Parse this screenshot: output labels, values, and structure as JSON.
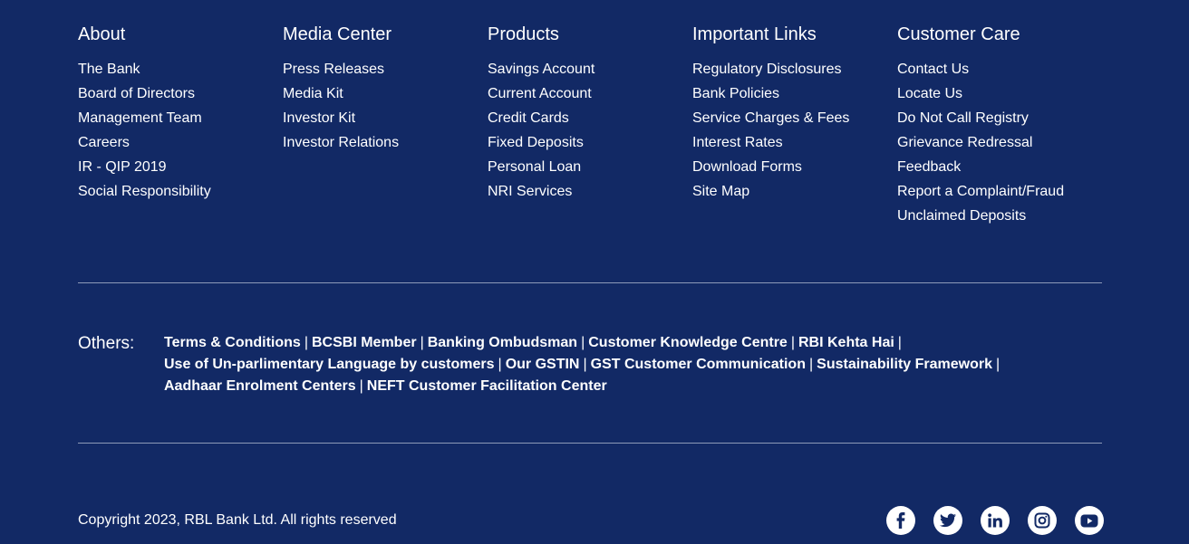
{
  "columns": [
    {
      "title": "About",
      "links": [
        "The Bank",
        "Board of Directors",
        "Management Team",
        "Careers",
        "IR - QIP 2019",
        "Social Responsibility"
      ]
    },
    {
      "title": "Media Center",
      "links": [
        "Press Releases",
        "Media Kit",
        "Investor Kit",
        "Investor Relations"
      ]
    },
    {
      "title": "Products",
      "links": [
        "Savings Account",
        "Current Account",
        "Credit Cards",
        "Fixed Deposits",
        "Personal Loan",
        "NRI Services"
      ]
    },
    {
      "title": "Important Links",
      "links": [
        "Regulatory Disclosures",
        "Bank Policies",
        "Service Charges & Fees",
        "Interest Rates",
        "Download Forms",
        "Site Map"
      ]
    },
    {
      "title": "Customer Care",
      "links": [
        "Contact Us",
        "Locate Us",
        "Do Not Call Registry",
        "Grievance Redressal",
        "Feedback",
        "Report a Complaint/Fraud",
        "Unclaimed Deposits"
      ]
    }
  ],
  "others": {
    "label": "Others:",
    "separator": "|",
    "lines": [
      [
        "Terms & Conditions",
        "BCSBI Member",
        "Banking Ombudsman",
        "Customer Knowledge Centre",
        "RBI Kehta Hai"
      ],
      [
        "Use of Un-parlimentary Language by customers",
        "Our GSTIN",
        "GST Customer Communication",
        "Sustainability Framework"
      ],
      [
        "Aadhaar Enrolment Centers",
        "NEFT Customer Facilitation Center"
      ]
    ]
  },
  "copyright": "Copyright 2023, RBL Bank Ltd. All rights reserved",
  "social": [
    {
      "name": "facebook-icon"
    },
    {
      "name": "twitter-icon"
    },
    {
      "name": "linkedin-icon"
    },
    {
      "name": "instagram-icon"
    },
    {
      "name": "youtube-icon"
    }
  ],
  "colors": {
    "background": "#122965",
    "text": "#ffffff",
    "divider": "#8d9ab8"
  }
}
